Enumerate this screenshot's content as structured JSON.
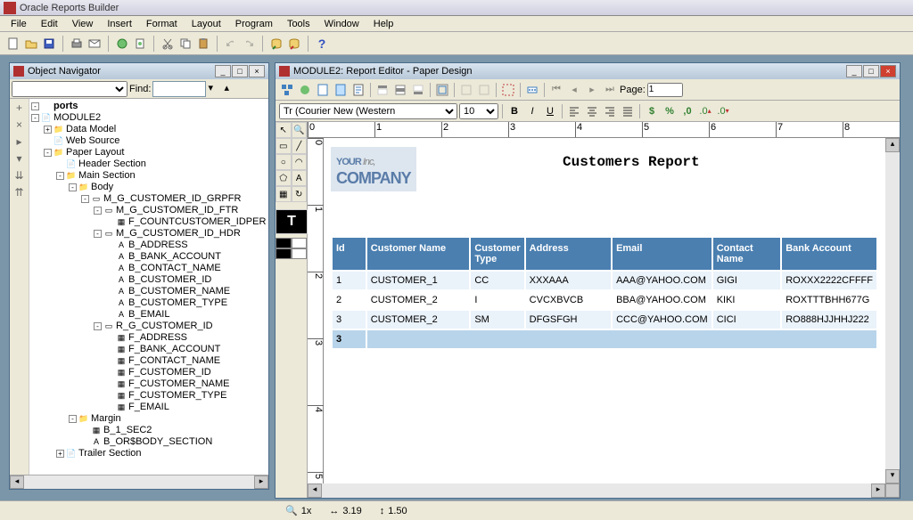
{
  "app": {
    "title": "Oracle Reports Builder"
  },
  "menu": [
    "File",
    "Edit",
    "View",
    "Insert",
    "Format",
    "Layout",
    "Program",
    "Tools",
    "Window",
    "Help"
  ],
  "objnav": {
    "title": "Object Navigator",
    "find_label": "Find:",
    "tree": [
      {
        "d": 0,
        "t": "-",
        "ic": "",
        "lbl": "ports",
        "bold": true
      },
      {
        "d": 0,
        "t": "-",
        "ic": "mod",
        "lbl": "MODULE2"
      },
      {
        "d": 1,
        "t": "+",
        "ic": "fld",
        "lbl": "Data Model"
      },
      {
        "d": 1,
        "t": "",
        "ic": "pg",
        "lbl": "Web Source"
      },
      {
        "d": 1,
        "t": "-",
        "ic": "fld",
        "lbl": "Paper Layout"
      },
      {
        "d": 2,
        "t": "",
        "ic": "pg",
        "lbl": "Header Section"
      },
      {
        "d": 2,
        "t": "-",
        "ic": "fld",
        "lbl": "Main Section"
      },
      {
        "d": 3,
        "t": "-",
        "ic": "fld",
        "lbl": "Body"
      },
      {
        "d": 4,
        "t": "-",
        "ic": "frm",
        "lbl": "M_G_CUSTOMER_ID_GRPFR"
      },
      {
        "d": 5,
        "t": "-",
        "ic": "frm",
        "lbl": "M_G_CUSTOMER_ID_FTR"
      },
      {
        "d": 6,
        "t": "",
        "ic": "fld2",
        "lbl": "F_COUNTCUSTOMER_IDPER"
      },
      {
        "d": 5,
        "t": "-",
        "ic": "frm",
        "lbl": "M_G_CUSTOMER_ID_HDR"
      },
      {
        "d": 6,
        "t": "",
        "ic": "txt",
        "lbl": "B_ADDRESS"
      },
      {
        "d": 6,
        "t": "",
        "ic": "txt",
        "lbl": "B_BANK_ACCOUNT"
      },
      {
        "d": 6,
        "t": "",
        "ic": "txt",
        "lbl": "B_CONTACT_NAME"
      },
      {
        "d": 6,
        "t": "",
        "ic": "txt",
        "lbl": "B_CUSTOMER_ID"
      },
      {
        "d": 6,
        "t": "",
        "ic": "txt",
        "lbl": "B_CUSTOMER_NAME"
      },
      {
        "d": 6,
        "t": "",
        "ic": "txt",
        "lbl": "B_CUSTOMER_TYPE"
      },
      {
        "d": 6,
        "t": "",
        "ic": "txt",
        "lbl": "B_EMAIL"
      },
      {
        "d": 5,
        "t": "-",
        "ic": "frm",
        "lbl": "R_G_CUSTOMER_ID"
      },
      {
        "d": 6,
        "t": "",
        "ic": "fld2",
        "lbl": "F_ADDRESS"
      },
      {
        "d": 6,
        "t": "",
        "ic": "fld2",
        "lbl": "F_BANK_ACCOUNT"
      },
      {
        "d": 6,
        "t": "",
        "ic": "fld2",
        "lbl": "F_CONTACT_NAME"
      },
      {
        "d": 6,
        "t": "",
        "ic": "fld2",
        "lbl": "F_CUSTOMER_ID"
      },
      {
        "d": 6,
        "t": "",
        "ic": "fld2",
        "lbl": "F_CUSTOMER_NAME"
      },
      {
        "d": 6,
        "t": "",
        "ic": "fld2",
        "lbl": "F_CUSTOMER_TYPE"
      },
      {
        "d": 6,
        "t": "",
        "ic": "fld2",
        "lbl": "F_EMAIL"
      },
      {
        "d": 3,
        "t": "-",
        "ic": "fld",
        "lbl": "Margin"
      },
      {
        "d": 4,
        "t": "",
        "ic": "fld2",
        "lbl": "B_1_SEC2"
      },
      {
        "d": 4,
        "t": "",
        "ic": "txt",
        "lbl": "B_OR$BODY_SECTION"
      },
      {
        "d": 2,
        "t": "+",
        "ic": "pg",
        "lbl": "Trailer Section"
      }
    ]
  },
  "editor": {
    "title": "MODULE2: Report Editor - Paper Design",
    "font": "Tr (Courier New (Western",
    "size": "10",
    "page_label": "Page:",
    "page_value": "1"
  },
  "report": {
    "logo1": "YOUR",
    "logo_inc": " Inc,",
    "logo2": "COMPANY",
    "title": "Customers Report",
    "columns": [
      "Id",
      "Customer Name",
      "Customer Type",
      "Address",
      "Email",
      "Contact Name",
      "Bank Account"
    ],
    "rows": [
      {
        "id": "1",
        "name": "CUSTOMER_1",
        "type": "CC",
        "addr": "XXXAAA",
        "email": "AAA@YAHOO.COM",
        "contact": "GIGI",
        "bank": "ROXXX2222CFFFF"
      },
      {
        "id": "2",
        "name": "CUSTOMER_2",
        "type": "I",
        "addr": "CVCXBVCB",
        "email": "BBA@YAHOO.COM",
        "contact": "KIKI",
        "bank": "ROXTTTBHH677G"
      },
      {
        "id": "3",
        "name": "CUSTOMER_2",
        "type": "SM",
        "addr": "DFGSFGH",
        "email": "CCC@YAHOO.COM",
        "contact": "CICI",
        "bank": "RO888HJJHHJ222"
      }
    ],
    "footer_count": "3"
  },
  "status": {
    "zoom": "1x",
    "x": "3.19",
    "y": "1.50"
  }
}
